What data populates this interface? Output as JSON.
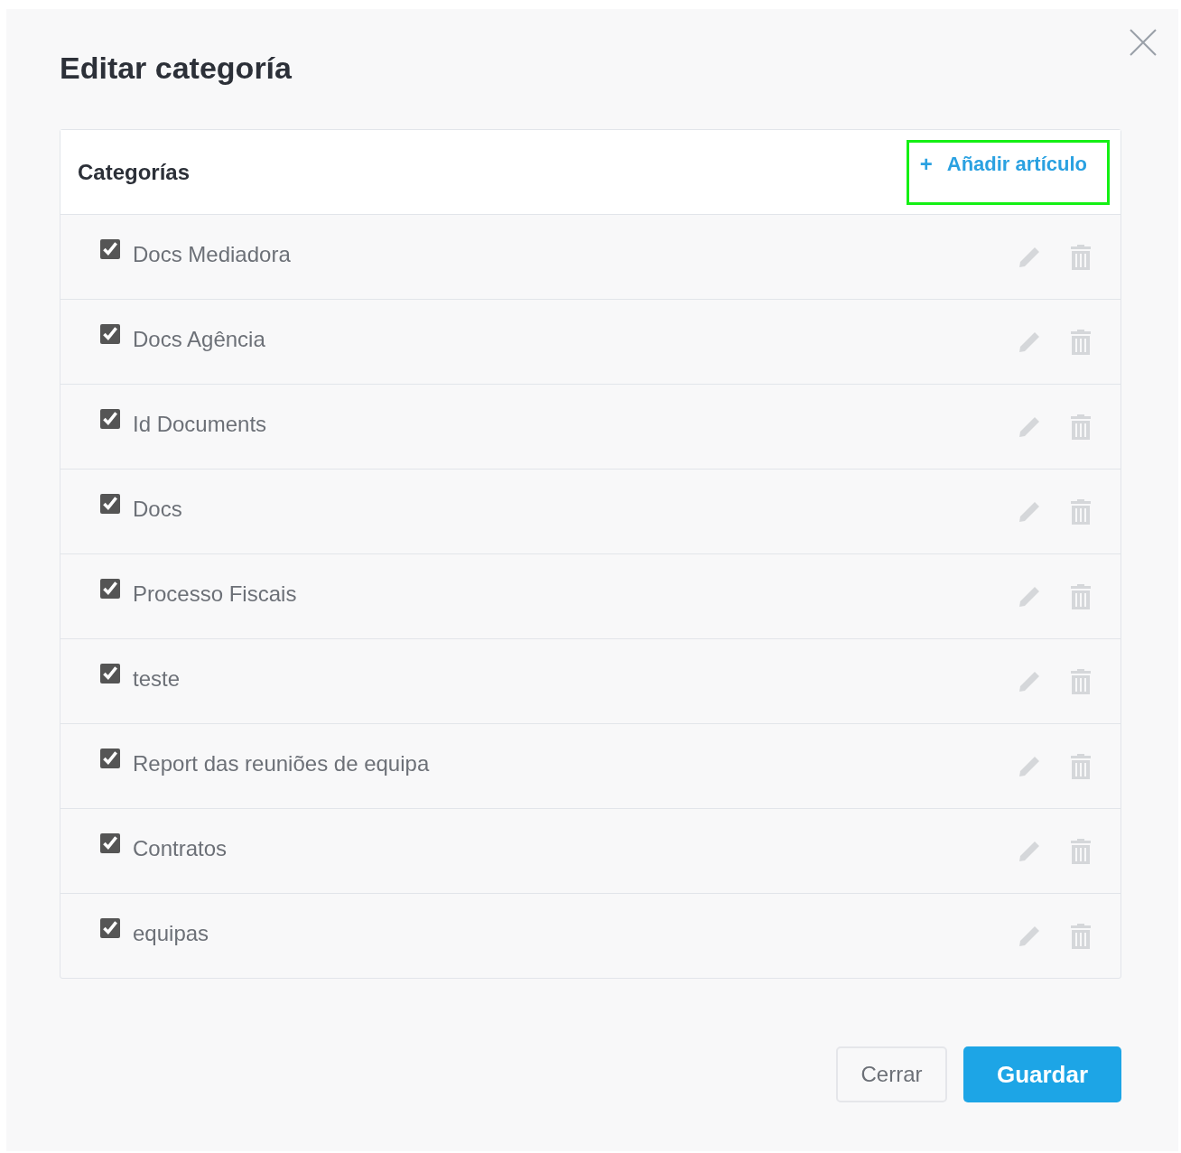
{
  "dialog": {
    "title": "Editar categoría"
  },
  "panel": {
    "title": "Categorías",
    "add_button": {
      "icon": "+",
      "label": "Añadir artículo",
      "highlighted": true
    }
  },
  "categories": [
    {
      "label": "Docs Mediadora",
      "checked": true
    },
    {
      "label": "Docs Agência",
      "checked": true
    },
    {
      "label": "Id Documents",
      "checked": true
    },
    {
      "label": "Docs",
      "checked": true
    },
    {
      "label": "Processo Fiscais",
      "checked": true
    },
    {
      "label": "teste",
      "checked": true
    },
    {
      "label": "Report das reuniões de equipa",
      "checked": true
    },
    {
      "label": "Contratos",
      "checked": true
    },
    {
      "label": "equipas",
      "checked": true
    }
  ],
  "buttons": [
    {
      "label": "Cerrar",
      "kind": "secondary"
    },
    {
      "label": "Guardar",
      "kind": "primary"
    }
  ]
}
